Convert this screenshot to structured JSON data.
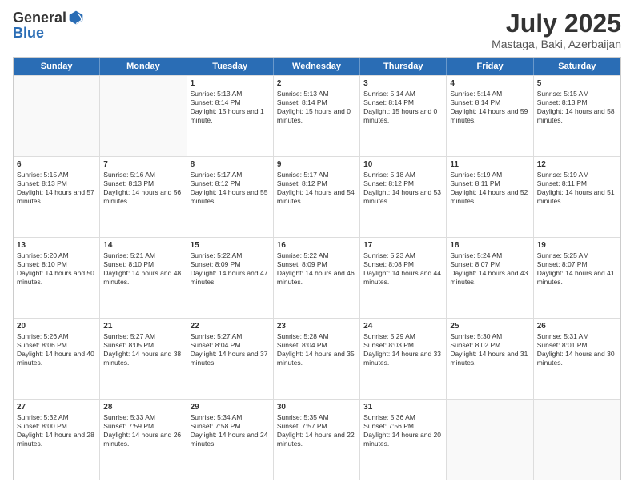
{
  "header": {
    "logo_general": "General",
    "logo_blue": "Blue",
    "title": "July 2025",
    "location": "Mastaga, Baki, Azerbaijan"
  },
  "days_of_week": [
    "Sunday",
    "Monday",
    "Tuesday",
    "Wednesday",
    "Thursday",
    "Friday",
    "Saturday"
  ],
  "weeks": [
    [
      {
        "day": "",
        "empty": true
      },
      {
        "day": "",
        "empty": true
      },
      {
        "day": "1",
        "sunrise": "Sunrise: 5:13 AM",
        "sunset": "Sunset: 8:14 PM",
        "daylight": "Daylight: 15 hours and 1 minute."
      },
      {
        "day": "2",
        "sunrise": "Sunrise: 5:13 AM",
        "sunset": "Sunset: 8:14 PM",
        "daylight": "Daylight: 15 hours and 0 minutes."
      },
      {
        "day": "3",
        "sunrise": "Sunrise: 5:14 AM",
        "sunset": "Sunset: 8:14 PM",
        "daylight": "Daylight: 15 hours and 0 minutes."
      },
      {
        "day": "4",
        "sunrise": "Sunrise: 5:14 AM",
        "sunset": "Sunset: 8:14 PM",
        "daylight": "Daylight: 14 hours and 59 minutes."
      },
      {
        "day": "5",
        "sunrise": "Sunrise: 5:15 AM",
        "sunset": "Sunset: 8:13 PM",
        "daylight": "Daylight: 14 hours and 58 minutes."
      }
    ],
    [
      {
        "day": "6",
        "sunrise": "Sunrise: 5:15 AM",
        "sunset": "Sunset: 8:13 PM",
        "daylight": "Daylight: 14 hours and 57 minutes."
      },
      {
        "day": "7",
        "sunrise": "Sunrise: 5:16 AM",
        "sunset": "Sunset: 8:13 PM",
        "daylight": "Daylight: 14 hours and 56 minutes."
      },
      {
        "day": "8",
        "sunrise": "Sunrise: 5:17 AM",
        "sunset": "Sunset: 8:12 PM",
        "daylight": "Daylight: 14 hours and 55 minutes."
      },
      {
        "day": "9",
        "sunrise": "Sunrise: 5:17 AM",
        "sunset": "Sunset: 8:12 PM",
        "daylight": "Daylight: 14 hours and 54 minutes."
      },
      {
        "day": "10",
        "sunrise": "Sunrise: 5:18 AM",
        "sunset": "Sunset: 8:12 PM",
        "daylight": "Daylight: 14 hours and 53 minutes."
      },
      {
        "day": "11",
        "sunrise": "Sunrise: 5:19 AM",
        "sunset": "Sunset: 8:11 PM",
        "daylight": "Daylight: 14 hours and 52 minutes."
      },
      {
        "day": "12",
        "sunrise": "Sunrise: 5:19 AM",
        "sunset": "Sunset: 8:11 PM",
        "daylight": "Daylight: 14 hours and 51 minutes."
      }
    ],
    [
      {
        "day": "13",
        "sunrise": "Sunrise: 5:20 AM",
        "sunset": "Sunset: 8:10 PM",
        "daylight": "Daylight: 14 hours and 50 minutes."
      },
      {
        "day": "14",
        "sunrise": "Sunrise: 5:21 AM",
        "sunset": "Sunset: 8:10 PM",
        "daylight": "Daylight: 14 hours and 48 minutes."
      },
      {
        "day": "15",
        "sunrise": "Sunrise: 5:22 AM",
        "sunset": "Sunset: 8:09 PM",
        "daylight": "Daylight: 14 hours and 47 minutes."
      },
      {
        "day": "16",
        "sunrise": "Sunrise: 5:22 AM",
        "sunset": "Sunset: 8:09 PM",
        "daylight": "Daylight: 14 hours and 46 minutes."
      },
      {
        "day": "17",
        "sunrise": "Sunrise: 5:23 AM",
        "sunset": "Sunset: 8:08 PM",
        "daylight": "Daylight: 14 hours and 44 minutes."
      },
      {
        "day": "18",
        "sunrise": "Sunrise: 5:24 AM",
        "sunset": "Sunset: 8:07 PM",
        "daylight": "Daylight: 14 hours and 43 minutes."
      },
      {
        "day": "19",
        "sunrise": "Sunrise: 5:25 AM",
        "sunset": "Sunset: 8:07 PM",
        "daylight": "Daylight: 14 hours and 41 minutes."
      }
    ],
    [
      {
        "day": "20",
        "sunrise": "Sunrise: 5:26 AM",
        "sunset": "Sunset: 8:06 PM",
        "daylight": "Daylight: 14 hours and 40 minutes."
      },
      {
        "day": "21",
        "sunrise": "Sunrise: 5:27 AM",
        "sunset": "Sunset: 8:05 PM",
        "daylight": "Daylight: 14 hours and 38 minutes."
      },
      {
        "day": "22",
        "sunrise": "Sunrise: 5:27 AM",
        "sunset": "Sunset: 8:04 PM",
        "daylight": "Daylight: 14 hours and 37 minutes."
      },
      {
        "day": "23",
        "sunrise": "Sunrise: 5:28 AM",
        "sunset": "Sunset: 8:04 PM",
        "daylight": "Daylight: 14 hours and 35 minutes."
      },
      {
        "day": "24",
        "sunrise": "Sunrise: 5:29 AM",
        "sunset": "Sunset: 8:03 PM",
        "daylight": "Daylight: 14 hours and 33 minutes."
      },
      {
        "day": "25",
        "sunrise": "Sunrise: 5:30 AM",
        "sunset": "Sunset: 8:02 PM",
        "daylight": "Daylight: 14 hours and 31 minutes."
      },
      {
        "day": "26",
        "sunrise": "Sunrise: 5:31 AM",
        "sunset": "Sunset: 8:01 PM",
        "daylight": "Daylight: 14 hours and 30 minutes."
      }
    ],
    [
      {
        "day": "27",
        "sunrise": "Sunrise: 5:32 AM",
        "sunset": "Sunset: 8:00 PM",
        "daylight": "Daylight: 14 hours and 28 minutes."
      },
      {
        "day": "28",
        "sunrise": "Sunrise: 5:33 AM",
        "sunset": "Sunset: 7:59 PM",
        "daylight": "Daylight: 14 hours and 26 minutes."
      },
      {
        "day": "29",
        "sunrise": "Sunrise: 5:34 AM",
        "sunset": "Sunset: 7:58 PM",
        "daylight": "Daylight: 14 hours and 24 minutes."
      },
      {
        "day": "30",
        "sunrise": "Sunrise: 5:35 AM",
        "sunset": "Sunset: 7:57 PM",
        "daylight": "Daylight: 14 hours and 22 minutes."
      },
      {
        "day": "31",
        "sunrise": "Sunrise: 5:36 AM",
        "sunset": "Sunset: 7:56 PM",
        "daylight": "Daylight: 14 hours and 20 minutes."
      },
      {
        "day": "",
        "empty": true
      },
      {
        "day": "",
        "empty": true
      }
    ]
  ]
}
